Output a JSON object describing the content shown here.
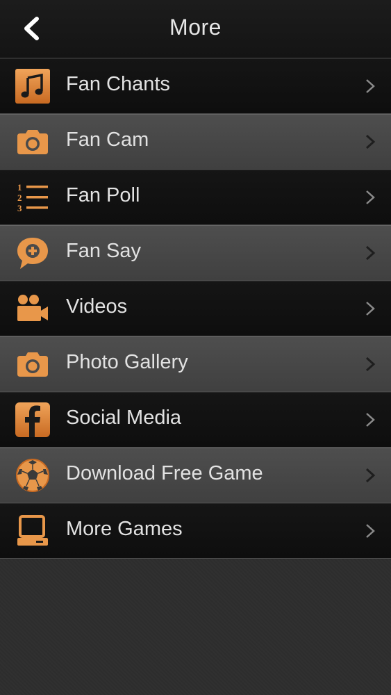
{
  "header": {
    "title": "More",
    "back_icon": "chevron-left-icon"
  },
  "colors": {
    "accent": "#e8974a",
    "accent_dark": "#b8621f",
    "text": "#e2e2e2"
  },
  "menu": {
    "items": [
      {
        "label": "Fan Chants",
        "icon": "music-note-icon"
      },
      {
        "label": "Fan Cam",
        "icon": "camera-icon"
      },
      {
        "label": "Fan Poll",
        "icon": "numbered-list-icon"
      },
      {
        "label": "Fan Say",
        "icon": "speech-bubble-plus-icon"
      },
      {
        "label": "Videos",
        "icon": "video-camera-icon"
      },
      {
        "label": "Photo Gallery",
        "icon": "camera-icon"
      },
      {
        "label": "Social Media",
        "icon": "facebook-icon"
      },
      {
        "label": "Download Free Game",
        "icon": "soccer-ball-icon"
      },
      {
        "label": "More Games",
        "icon": "computer-icon"
      }
    ]
  }
}
